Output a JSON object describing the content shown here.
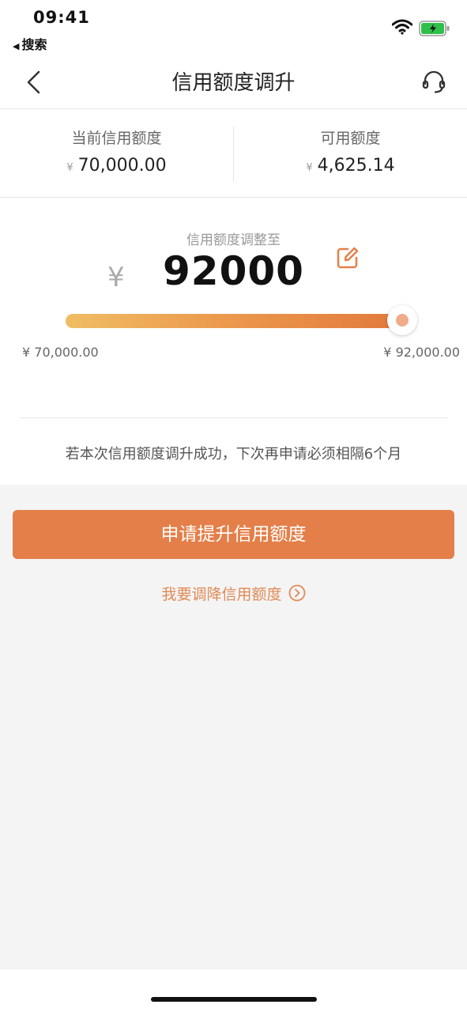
{
  "status_bar": {
    "time": "09:41",
    "back_app": "搜索"
  },
  "nav": {
    "title": "信用额度调升"
  },
  "summary": {
    "current_label": "当前信用额度",
    "current_value": "70,000.00",
    "available_label": "可用额度",
    "available_value": "4,625.14",
    "currency": "¥"
  },
  "adjust": {
    "label": "信用额度调整至",
    "currency": "¥",
    "amount": "92000",
    "slider_fraction": 1.0,
    "min_label": "¥ 70,000.00",
    "max_label": "¥ 92,000.00"
  },
  "notice": "若本次信用额度调升成功，下次再申请必须相隔6个月",
  "buttons": {
    "apply": "申请提升信用额度",
    "decrease": "我要调降信用额度"
  },
  "colors": {
    "accent": "#e47f49",
    "slider_start": "#f0bd63",
    "slider_end": "#e27a3b",
    "link": "#e08a55"
  },
  "icons": [
    "back-arrow-icon",
    "customer-service-icon",
    "edit-icon",
    "chevron-right-circle-icon",
    "wifi-icon",
    "battery-icon"
  ]
}
